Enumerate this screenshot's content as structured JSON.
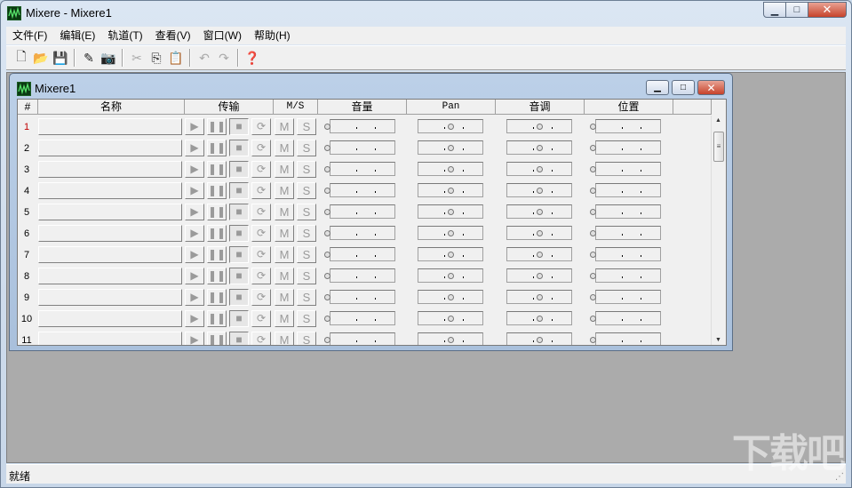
{
  "window": {
    "title": "Mixere - Mixere1"
  },
  "menu": [
    "文件(F)",
    "编辑(E)",
    "轨道(T)",
    "查看(V)",
    "窗口(W)",
    "帮助(H)"
  ],
  "toolbar": {
    "buttons": [
      "new-file-icon",
      "open-folder-icon",
      "save-icon",
      "wand-icon",
      "camera-icon",
      "cut-icon",
      "copy-icon",
      "paste-icon",
      "undo-icon",
      "redo-icon",
      "help-icon"
    ]
  },
  "child": {
    "title": "Mixere1",
    "columns": [
      "#",
      "名称",
      "传输",
      "M/S",
      "音量",
      "Pan",
      "音调",
      "位置"
    ],
    "rows": [
      "1",
      "2",
      "3",
      "4",
      "5",
      "6",
      "7",
      "8",
      "9",
      "10",
      "11"
    ],
    "active_row": "1",
    "mute_label": "M",
    "solo_label": "S"
  },
  "status": {
    "text": "就绪"
  },
  "watermark": "下载吧",
  "colors": {
    "active_row_number": "#c00000",
    "workspace": "#ababab"
  }
}
